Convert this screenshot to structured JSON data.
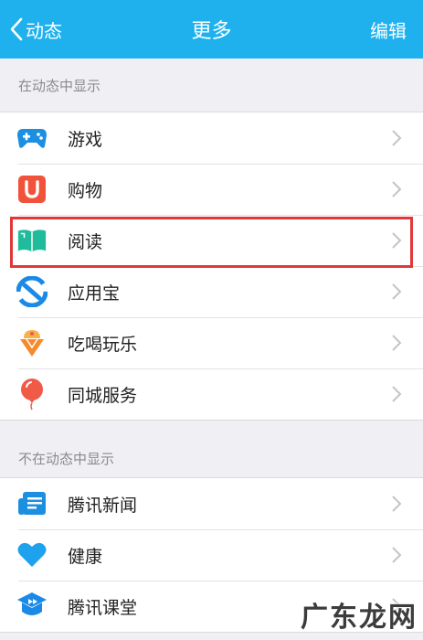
{
  "navbar": {
    "back_label": "动态",
    "title": "更多",
    "edit_label": "编辑",
    "color": "#1fb1ee"
  },
  "sections": [
    {
      "header": "在动态中显示",
      "items": [
        {
          "label": "游戏",
          "icon": "gamepad-icon",
          "color": "#1d8fe0"
        },
        {
          "label": "购物",
          "icon": "shopping-bag-icon",
          "color": "#f0533a"
        },
        {
          "label": "阅读",
          "icon": "book-icon",
          "color": "#1fbb9a",
          "highlighted": true
        },
        {
          "label": "应用宝",
          "icon": "app-store-icon",
          "color": "#1a8ae6"
        },
        {
          "label": "吃喝玩乐",
          "icon": "ice-cream-icon",
          "color": "#f59a2e"
        },
        {
          "label": "同城服务",
          "icon": "balloon-icon",
          "color": "#f05b48"
        }
      ]
    },
    {
      "header": "不在动态中显示",
      "items": [
        {
          "label": "腾讯新闻",
          "icon": "news-icon",
          "color": "#1d8fe0"
        },
        {
          "label": "健康",
          "icon": "heart-icon",
          "color": "#1fa2ee"
        },
        {
          "label": "腾讯课堂",
          "icon": "classroom-icon",
          "color": "#1a8ae6"
        }
      ]
    }
  ],
  "watermark": "广东龙网",
  "highlight_color": "#e0393a"
}
